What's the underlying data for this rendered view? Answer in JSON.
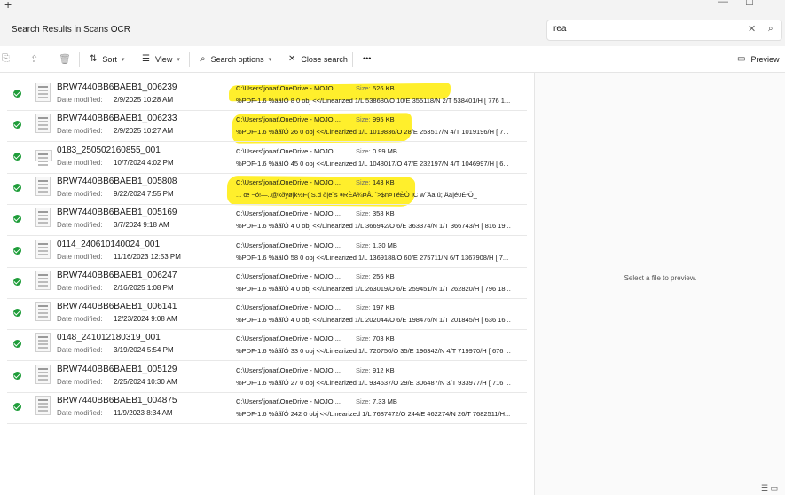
{
  "window": {
    "new_tab": "+",
    "minimize": "—",
    "maximize": "☐"
  },
  "addressbar": {
    "title": "Search Results in Scans OCR",
    "search_value": "rea",
    "clear_icon": "✕",
    "search_icon": "⌕"
  },
  "toolbar": {
    "sort_label": "Sort",
    "view_label": "View",
    "search_options_label": "Search options",
    "close_search_label": "Close search",
    "more_label": "•••",
    "preview_label": "Preview"
  },
  "list": {
    "date_modified_label": "Date modified:",
    "size_label": "Size:",
    "rows": [
      {
        "name": "BRW7440BB6BAEB1_006239",
        "date": "2/9/2025 10:28 AM",
        "path": "C:\\Users\\jonat\\OneDrive - MOJO ...",
        "size": "526 KB",
        "content": "%PDF-1.6 %âãÏÓ 8 0 obj <</Linearized 1/L 538680/O 10/E 355118/N 2/T 538401/H [ 776 1..."
      },
      {
        "name": "BRW7440BB6BAEB1_006233",
        "date": "2/9/2025 10:27 AM",
        "path": "C:\\Users\\jonat\\OneDrive - MOJO ...",
        "size": "995 KB",
        "content": "%PDF-1.6 %âãÏÓ 26 0 obj <</Linearized 1/L 1019836/O 28/E 253517/N 4/T 1019196/H [ 7..."
      },
      {
        "name": "0183_250502160855_001",
        "date": "10/7/2024 4:02 PM",
        "path": "C:\\Users\\jonat\\OneDrive - MOJO ...",
        "size": "0.99 MB",
        "content": "%PDF-1.6 %âãÏÓ 45 0 obj <</Linearized 1/L 1048017/O 47/E 232197/N 4/T 1046997/H [ 6..."
      },
      {
        "name": "BRW7440BB6BAEB1_005808",
        "date": "9/22/2024 7:55 PM",
        "path": "C:\\Users\\jonat\\OneDrive - MOJO ...",
        "size": "143 KB",
        "content": "... œ ~ó!—..@kðyø|k½F( S.d ð|e˜s ¥RÈÄ¾ÞÂ. ˜>$n¤TéÈÒ ìC w˜Äa ú; Ää|é0Ë²Ö_"
      },
      {
        "name": "BRW7440BB6BAEB1_005169",
        "date": "3/7/2024 9:18 AM",
        "path": "C:\\Users\\jonat\\OneDrive - MOJO ...",
        "size": "358 KB",
        "content": "%PDF-1.6 %âãÏÓ 4 0 obj <</Linearized 1/L 366942/O 6/E 363374/N 1/T 366743/H [ 816 19..."
      },
      {
        "name": "0114_240610140024_001",
        "date": "11/16/2023 12:53 PM",
        "path": "C:\\Users\\jonat\\OneDrive - MOJO ...",
        "size": "1.30 MB",
        "content": "%PDF-1.6 %âãÏÓ 58 0 obj <</Linearized 1/L 1369188/O 60/E 275711/N 6/T 1367908/H [ 7..."
      },
      {
        "name": "BRW7440BB6BAEB1_006247",
        "date": "2/16/2025 1:08 PM",
        "path": "C:\\Users\\jonat\\OneDrive - MOJO ...",
        "size": "256 KB",
        "content": "%PDF-1.6 %âãÏÓ 4 0 obj <</Linearized 1/L 263019/O 6/E 259451/N 1/T 262820/H [ 796 18..."
      },
      {
        "name": "BRW7440BB6BAEB1_006141",
        "date": "12/23/2024 9:08 AM",
        "path": "C:\\Users\\jonat\\OneDrive - MOJO ...",
        "size": "197 KB",
        "content": "%PDF-1.6 %âãÏÓ 4 0 obj <</Linearized 1/L 202044/O 6/E 198476/N 1/T 201845/H [ 636 16..."
      },
      {
        "name": "0148_241012180319_001",
        "date": "3/19/2024 5:54 PM",
        "path": "C:\\Users\\jonat\\OneDrive - MOJO ...",
        "size": "703 KB",
        "content": "%PDF-1.6 %âãÏÓ 33 0 obj <</Linearized 1/L 720750/O 35/E 196342/N 4/T 719970/H [ 676 ..."
      },
      {
        "name": "BRW7440BB6BAEB1_005129",
        "date": "2/25/2024 10:30 AM",
        "path": "C:\\Users\\jonat\\OneDrive - MOJO ...",
        "size": "912 KB",
        "content": "%PDF-1.6 %âãÏÓ 27 0 obj <</Linearized 1/L 934637/O 29/E 306487/N 3/T 933977/H [ 716 ..."
      },
      {
        "name": "BRW7440BB6BAEB1_004875",
        "date": "11/9/2023 8:34 AM",
        "path": "C:\\Users\\jonat\\OneDrive - MOJO ...",
        "size": "7.33 MB",
        "content": "%PDF-1.6 %âãÏÓ 242 0 obj <</Linearized 1/L 7687472/O 244/E 462274/N 26/T 7682511/H..."
      }
    ]
  },
  "preview": {
    "message": "Select a file to preview."
  },
  "colors": {
    "status_ok": "#1f9d3a",
    "highlight": "#ffee1a"
  }
}
